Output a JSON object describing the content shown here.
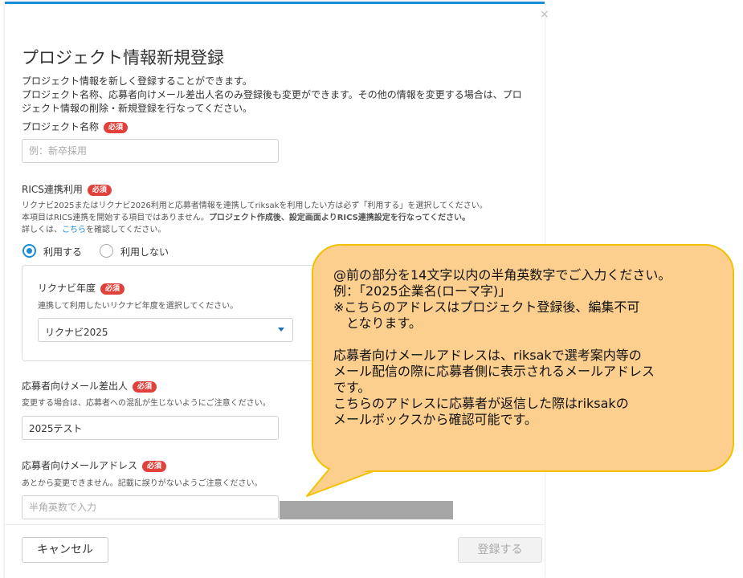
{
  "modal": {
    "title": "プロジェクト情報新規登録",
    "description": [
      "プロジェクト情報を新しく登録することができます。",
      "プロジェクト名称、応募者向けメール差出人名のみ登録後も変更ができます。その他の情報を変更する場合は、プロ",
      "ジェクト情報の削除・新規登録を行なってください。"
    ],
    "close_label": "×"
  },
  "project_name": {
    "label": "プロジェクト名称",
    "required_badge": "必須",
    "placeholder": "例：新卒採用",
    "value": ""
  },
  "rics": {
    "label": "RICS連携利用",
    "required_badge": "必須",
    "help_line1": "リクナビ2025またはリクナビ2026利用と応募者情報を連携してriksakを利用したい方は必ず「利用する」を選択してください。",
    "help_line2_normal": "本項目はRICS連携を開始する項目ではありません。",
    "help_line2_bold": "プロジェクト作成後、設定画面よりRICS連携設定を行なってください。",
    "help_line3_prefix": "詳しくは、",
    "help_link": "こちら",
    "help_line3_suffix": "を確認してください。",
    "options": [
      {
        "label": "利用する",
        "selected": true
      },
      {
        "label": "利用しない",
        "selected": false
      }
    ]
  },
  "rikunabi_year": {
    "label": "リクナビ年度",
    "required_badge": "必須",
    "help": "連携して利用したいリクナビ年度を選択してください。",
    "selected": "リクナビ2025"
  },
  "sender_name": {
    "label": "応募者向けメール差出人",
    "required_badge": "必須",
    "help": "変更する場合は、応募者への混乱が生じないようにご注意ください。",
    "value": "2025テスト"
  },
  "email": {
    "label": "応募者向けメールアドレス",
    "required_badge": "必須",
    "help": "あとから変更できません。記載に誤りがないようご注意ください。",
    "placeholder": "半角英数で入力",
    "value": ""
  },
  "footer": {
    "cancel_label": "キャンセル",
    "submit_label": "登録する"
  },
  "callout": {
    "lines": [
      "@前の部分を14文字以内の半角英数字でご入力ください。",
      "例：「2025企業名(ローマ字)」",
      "※こちらのアドレスはプロジェクト登録後、編集不可",
      "　となります。",
      "",
      "応募者向けメールアドレスは、riksakで選考案内等の",
      "メール配信の際に応募者側に表示されるメールアドレス",
      "です。",
      "こちらのアドレスに応募者が返信した際はriksakの",
      "メールボックスから確認可能です。"
    ]
  },
  "colors": {
    "accent": "#1a8cd8",
    "required_badge": "#e2403a",
    "callout_fill": "#fccf8e",
    "callout_border": "#f2c200"
  }
}
